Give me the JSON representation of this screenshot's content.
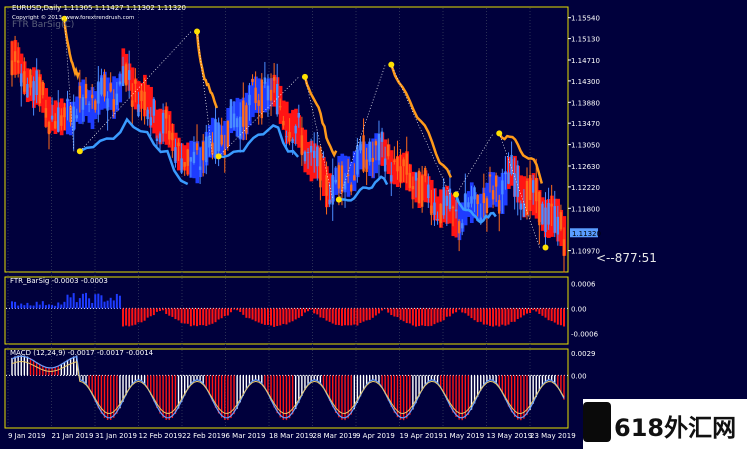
{
  "app": {
    "title": "EURUSD,Daily 1.11305 1.11427 1.11302 1.11320",
    "copyright": "Copyright © 2013, www.forextrendrush.com",
    "indicator_name": "FTR BarSig(C)",
    "countdown": "<--877:51",
    "watermark": "618外汇网"
  },
  "colors": {
    "background": "#00003c",
    "grid": "#2a2f55",
    "border": "#e8e000",
    "bull": "#1e3cff",
    "bear": "#ff1414",
    "trail_bear": "#ff9a1a",
    "trail_bull": "#3a9bff",
    "dot": "#ffe000",
    "price_tag_bg": "#5a9cff"
  },
  "chart_data": [
    {
      "type": "candlestick",
      "title": "EURUSD,Daily 1.11305 1.11427 1.11302 1.11320",
      "ylim": [
        1.1055,
        1.1575
      ],
      "ticks": [
        "1.15540",
        "1.15130",
        "1.14710",
        "1.14300",
        "1.13880",
        "1.13470",
        "1.13050",
        "1.12630",
        "1.12220",
        "1.11800",
        "1.11320",
        "1.10970"
      ],
      "tick_values": [
        1.1554,
        1.1513,
        1.1471,
        1.143,
        1.1388,
        1.1347,
        1.1305,
        1.1263,
        1.1222,
        1.118,
        1.1132,
        1.1097
      ],
      "current_price": "1.11320",
      "current_price_value": 1.1132,
      "trend_segments": [
        {
          "from": 0,
          "to": 15,
          "trend": "bear",
          "start": 1.1475,
          "end": 1.135
        },
        {
          "from": 18,
          "to": 35,
          "trend": "bull",
          "start": 1.1365,
          "end": 1.1415
        },
        {
          "from": 36,
          "to": 55,
          "trend": "bear",
          "start": 1.145,
          "end": 1.129
        },
        {
          "from": 58,
          "to": 82,
          "trend": "bull",
          "start": 1.1265,
          "end": 1.141
        },
        {
          "from": 85,
          "to": 102,
          "trend": "bear",
          "start": 1.14,
          "end": 1.123
        },
        {
          "from": 104,
          "to": 118,
          "trend": "bull",
          "start": 1.1225,
          "end": 1.1295
        },
        {
          "from": 120,
          "to": 143,
          "trend": "bear",
          "start": 1.1285,
          "end": 1.1165
        },
        {
          "from": 145,
          "to": 160,
          "trend": "bull",
          "start": 1.1165,
          "end": 1.1225
        },
        {
          "from": 161,
          "to": 179,
          "trend": "bear",
          "start": 1.1245,
          "end": 1.1135
        }
      ],
      "dot_points": [
        {
          "bar": 17,
          "price": 1.1552
        },
        {
          "bar": 22,
          "price": 1.1292
        },
        {
          "bar": 60,
          "price": 1.1527
        },
        {
          "bar": 67,
          "price": 1.1282
        },
        {
          "bar": 95,
          "price": 1.1438
        },
        {
          "bar": 106,
          "price": 1.1197
        },
        {
          "bar": 123,
          "price": 1.1462
        },
        {
          "bar": 144,
          "price": 1.1207
        },
        {
          "bar": 158,
          "price": 1.1327
        },
        {
          "bar": 173,
          "price": 1.1103
        }
      ],
      "bars": 180
    },
    {
      "type": "bar",
      "title": "FTR_BarSig -0.0003 -0.0003",
      "ticks": [
        "0.0006",
        "0.00",
        "-0.0006"
      ],
      "tick_values": [
        0.0006,
        0.0,
        -0.0006
      ],
      "ylim": [
        -0.00085,
        0.00075
      ]
    },
    {
      "type": "bar",
      "title": "MACD (12,24,9) -0.0017 -0.0017 -0.0014",
      "ticks": [
        "0.0029",
        "0.00"
      ],
      "tick_values": [
        0.0029,
        0.0
      ],
      "ylim": [
        -0.0068,
        0.0034
      ]
    }
  ],
  "x_axis_labels": [
    "9 Jan 2019",
    "21 Jan 2019",
    "31 Jan 2019",
    "12 Feb 2019",
    "22 Feb 2019",
    "6 Mar 2019",
    "18 Mar 2019",
    "28 Mar 2019",
    "9 Apr 2019",
    "19 Apr 2019",
    "1 May 2019",
    "13 May 2019",
    "23 May 2019"
  ]
}
